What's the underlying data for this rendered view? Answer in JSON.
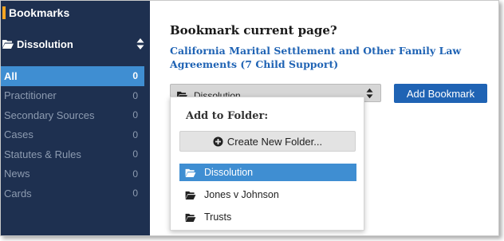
{
  "colors": {
    "sidebar_bg": "#1e3050",
    "sidebar_active": "#3f8ed2",
    "brand_blue": "#1f63b4",
    "title_marker": "#f5a623"
  },
  "sidebar": {
    "title": "Bookmarks",
    "current_folder": "Dissolution",
    "items": [
      {
        "label": "All",
        "count": "0",
        "active": true
      },
      {
        "label": "Practitioner",
        "count": "0"
      },
      {
        "label": "Secondary Sources",
        "count": "0"
      },
      {
        "label": "Cases",
        "count": "0"
      },
      {
        "label": "Statutes & Rules",
        "count": "0"
      },
      {
        "label": "News",
        "count": "0"
      },
      {
        "label": "Cards",
        "count": "0"
      }
    ]
  },
  "main": {
    "heading": "Bookmark current page?",
    "page_title": "California Marital Settlement and Other Family Law Agreements (7 Child Support)",
    "folder_select_value": "Dissolution",
    "add_button": "Add Bookmark"
  },
  "dropdown": {
    "title": "Add to Folder:",
    "create_button": "Create New Folder...",
    "folders": [
      {
        "label": "Dissolution",
        "selected": true
      },
      {
        "label": "Jones v Johnson"
      },
      {
        "label": "Trusts"
      }
    ]
  },
  "icons": [
    "bookmark-marker-icon",
    "folder-open-icon",
    "sort-updown-icon",
    "plus-circle-icon"
  ]
}
